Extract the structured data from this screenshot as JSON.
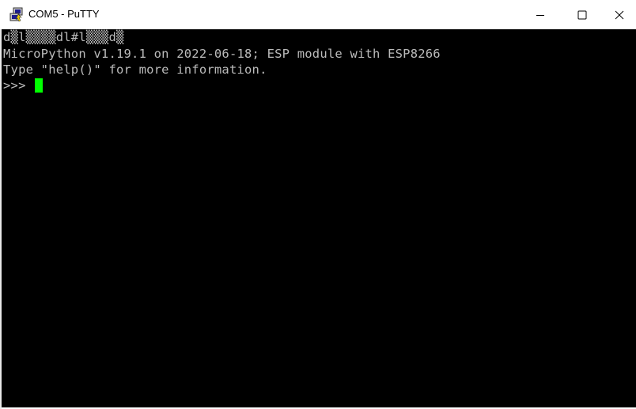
{
  "window": {
    "title": "COM5 - PuTTY",
    "icon": "putty-icon"
  },
  "controls": {
    "minimize_icon": "minimize-icon",
    "maximize_icon": "maximize-icon",
    "close_icon": "close-icon"
  },
  "terminal": {
    "lines": [
      "d▒l▒▒▒▒dl#l▒▒▒d▒",
      "MicroPython v1.19.1 on 2022-06-18; ESP module with ESP8266",
      "Type \"help()\" for more information.",
      ">>> "
    ],
    "background": "#000000",
    "foreground": "#bbbbbb",
    "cursor_color": "#00ff00"
  }
}
